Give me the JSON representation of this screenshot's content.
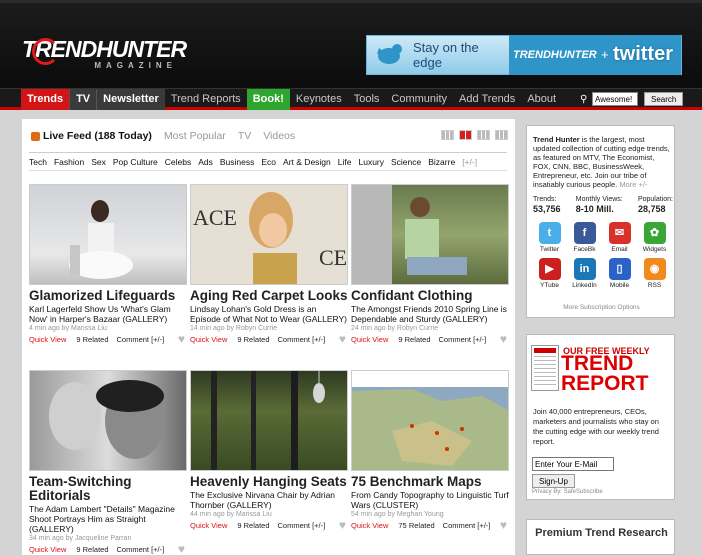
{
  "header": {
    "logo_main": "TRENDHUNTER",
    "logo_sub": "MAGAZINE",
    "banner": {
      "tagline": "Stay on the edge",
      "brand": "TRENDHUNTER",
      "plus": "+",
      "partner": "twitter"
    }
  },
  "nav": {
    "items": [
      {
        "label": "Trends"
      },
      {
        "label": "TV"
      },
      {
        "label": "Newsletter"
      },
      {
        "label": "Trend Reports"
      },
      {
        "label": "Book!"
      },
      {
        "label": "Keynotes"
      },
      {
        "label": "Tools"
      },
      {
        "label": "Community"
      },
      {
        "label": "Add Trends"
      },
      {
        "label": "About"
      }
    ],
    "search_value": "Awesome!",
    "search_button": "Search"
  },
  "feed": {
    "tabs": [
      {
        "label": "Live Feed (188 Today)"
      },
      {
        "label": "Most Popular"
      },
      {
        "label": "TV"
      },
      {
        "label": "Videos"
      }
    ],
    "categories": [
      "Tech",
      "Fashion",
      "Sex",
      "Pop Culture",
      "Celebs",
      "Ads",
      "Business",
      "Eco",
      "Art & Design",
      "Life",
      "Luxury",
      "Science",
      "Bizarre",
      "[+/-]"
    ],
    "quick_view": "Quick View",
    "comment": "Comment [+/-]",
    "cards": [
      {
        "title": "Glamorized Lifeguards",
        "desc": "Karl Lagerfeld Show Us 'What's Glam Now' in Harper's Bazaar (GALLERY)",
        "meta": "4 min ago by Marissa Liu",
        "related": "9 Related"
      },
      {
        "title": "Aging Red Carpet Looks",
        "desc": "Lindsay Lohan's Gold Dress is an Episode of What Not to Wear (GALLERY)",
        "meta": "14 min ago by Robyn Currie",
        "related": "9 Related"
      },
      {
        "title": "Confidant Clothing",
        "desc": "The Amongst Friends 2010 Spring Line is Dependable and Sturdy (GALLERY)",
        "meta": "24 min ago by Robyn Currie",
        "related": "9 Related"
      },
      {
        "title": "Team-Switching Editorials",
        "desc": "The Adam Lambert \"Details\" Magazine Shoot Portrays Him as Straight (GALLERY)",
        "meta": "34 min ago by Jacqueline Parran",
        "related": "9 Related"
      },
      {
        "title": "Heavenly Hanging Seats",
        "desc": "The Exclusive Nirvana Chair by Adrian Thornber (GALLERY)",
        "meta": "44 min ago by Marissa Liu",
        "related": "9 Related"
      },
      {
        "title": "75 Benchmark Maps",
        "desc": "From Candy Topography to Linguistic Turf Wars (CLUSTER)",
        "meta": "54 min ago by Meghan Young",
        "related": "75 Related"
      }
    ]
  },
  "sidebar": {
    "intro_brand": "Trend Hunter",
    "intro": " is the largest, most updated collection of cutting edge trends, as featured on MTV, The Economist, FOX, CNN, BBC, BusinessWeek, Entrepreneur, etc. Join our tribe of insatiably curious people.",
    "intro_more": "More +/-",
    "stats": [
      {
        "label": "Trends:",
        "value": "53,756"
      },
      {
        "label": "Monthly Views:",
        "value": "8-10 Mill."
      },
      {
        "label": "Population:",
        "value": "28,758"
      }
    ],
    "socials": [
      {
        "label": "Twitter",
        "color": "#4aaee8",
        "glyph": "t"
      },
      {
        "label": "FaceBk",
        "color": "#3b5998",
        "glyph": "f"
      },
      {
        "label": "Email",
        "color": "#d9302a",
        "glyph": "✉"
      },
      {
        "label": "Widgets",
        "color": "#3aa635",
        "glyph": "✿"
      },
      {
        "label": "YTube",
        "color": "#cc1f1f",
        "glyph": "▶"
      },
      {
        "label": "LinkedIn",
        "color": "#1b77b5",
        "glyph": "in"
      },
      {
        "label": "Mobile",
        "color": "#2a62c7",
        "glyph": "▯"
      },
      {
        "label": "RSS",
        "color": "#f08a1c",
        "glyph": "◉"
      }
    ],
    "sub_options": "More Subscription Options",
    "report": {
      "free": "OUR FREE WEEKLY",
      "title": "TREND REPORT",
      "desc": "Join 40,000 entrepreneurs, CEOs, marketers and journalists who stay on the cutting edge with our weekly trend report.",
      "email_value": "Enter Your E-Mail",
      "signup": "Sign-Up",
      "privacy": "Privacy By: SafeSubscribe"
    },
    "premium": "Premium Trend Research"
  }
}
